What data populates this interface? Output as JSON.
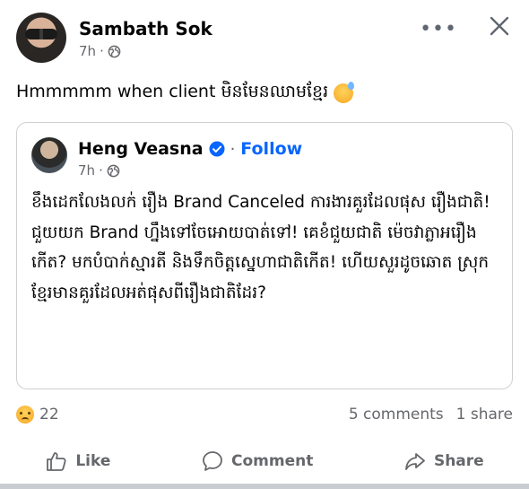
{
  "post": {
    "author": "Sambath Sok",
    "time": "7h",
    "dot": "·",
    "text": "Hmmmmm when client មិនមែនឈាមខ្មែរ",
    "more_label": "•••"
  },
  "shared_post": {
    "author": "Heng Veasna",
    "dot": "·",
    "follow_label": "Follow",
    "time": "7h",
    "body": "ខឹងដេកលែងលក់ រឿង Brand Canceled ការងារគួរដែលផុស រឿងជាតិ! ជួយយក Brand ហ្នឹងទៅចែអោយបាត់ទៅ! គេខំជួយជាតិ ម៉េចវាភ្លាអរឿងកើត? មកបំបាក់ស្មារតី និងទឹកចិត្តស្នេហាជាតិកើត! ហើយសួរដូចឆោត ស្រុកខ្មែរមានគួរដែលអត់ផុសពីរឿងជាតិដែរ?"
  },
  "stats": {
    "reactions_count": "22",
    "comments": "5 comments",
    "shares": "1 share"
  },
  "actions": {
    "like": "Like",
    "comment": "Comment",
    "share": "Share"
  },
  "icons": {
    "globe": "globe-icon",
    "verified": "verified-badge-icon",
    "reaction": "sad-face-icon",
    "emoji": "sweat-smile-emoji-icon"
  },
  "colors": {
    "accent": "#0866ff",
    "secondary_text": "#65676b"
  }
}
